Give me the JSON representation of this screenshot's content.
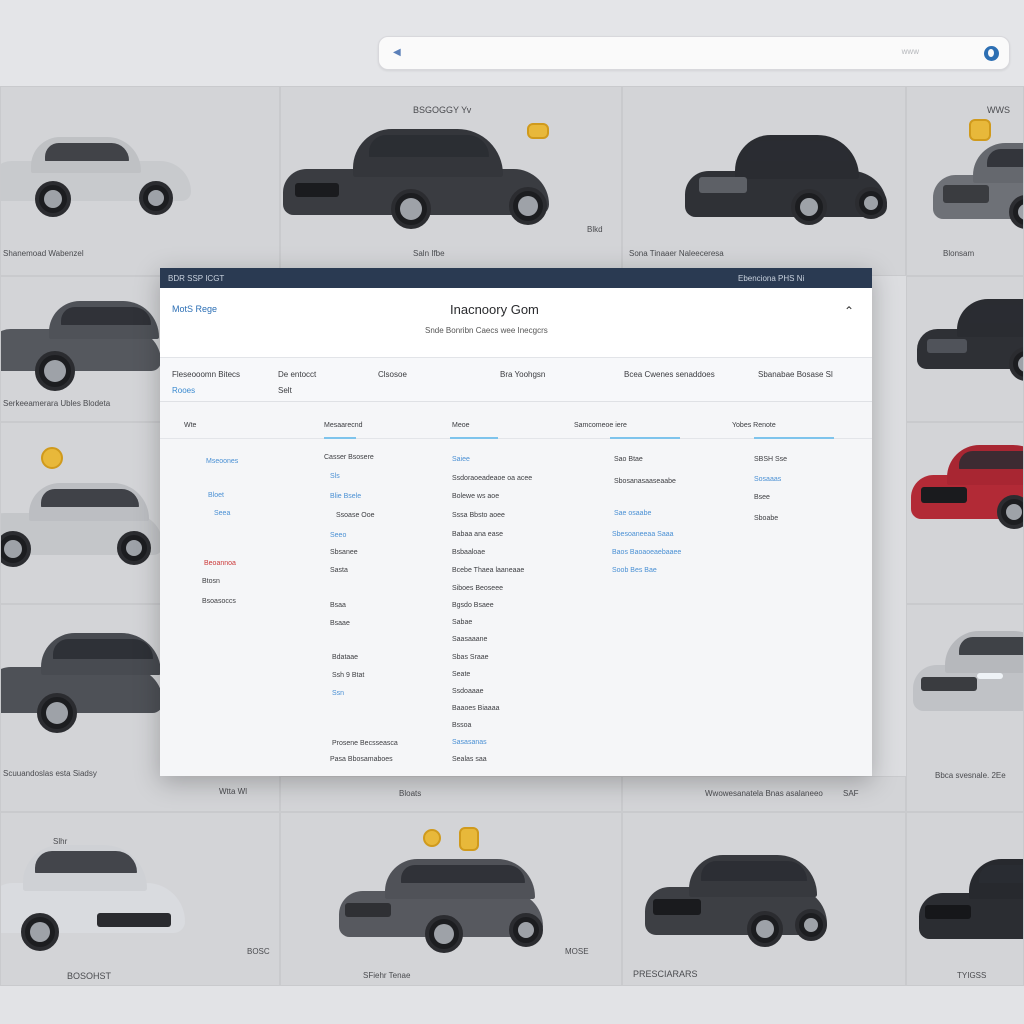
{
  "browser": {
    "url": "www"
  },
  "tiles": {
    "r1c2_top": "BSGOGGY   Yv",
    "r1c1_caption": "Shanemoad   Wabenzel",
    "r1c2_caption": "Saln   Ifbe",
    "r1c2_mark": "Blkd",
    "r1c3_caption": "Sona   Tinaaer Naleeceresa",
    "r1c4_top": "WWS",
    "r1c4_caption": "Blonsam",
    "r2c1_caption": "Serkeeamerara   Ubles   Blodeta",
    "r4c1_caption": "Scuuandoslas esta   Siadsy",
    "r4c1_sub": "Wtta Wl",
    "r4c2_caption": "Bloats",
    "r4c3_caption": "Bbca svesnale. 2Ee",
    "r4c4_caption": "Wwowesanatela Bnas asalaneeo",
    "r4c5_mark": "SAF",
    "r5c1_top": "Slhr",
    "r5c1_caption": "BOSOHST",
    "r5c1_mark": "BOSC",
    "r5c2_caption": "SFiehr Tenae",
    "r5c2_mark": "MOSE",
    "r5c3_caption": "PRESCIARARS",
    "r5c4_caption": "TYIGSS"
  },
  "dialog": {
    "titlebar_left": "BDR  SSP   ICGT",
    "titlebar_right": "Ebenciona   PHS   Ni",
    "brand": "MotS Rege",
    "title": "Inacnoory Gom",
    "subtitle": "Snde Bonribn Caecs   wee Inecgcrs",
    "filters": {
      "f1": "Fleseooomn Bitecs",
      "f2": "De entocct",
      "f3": "Clsosoe",
      "f4": "Bra Yoohgsn",
      "f5": "Bcea Cwenes senaddoes",
      "f6": "Sbanabae Bosase Sl",
      "f1_sub": "Rooes",
      "f2_sub": "Selt"
    },
    "columns": [
      "Wte",
      "Mesaarecnd",
      "Meoe",
      "Samcomeoe iere",
      "Yobes Renote"
    ],
    "col1": [
      "Mseoones",
      "Bloet",
      "Seea",
      "Beoannoa",
      "Btosn",
      "Bsoasoccs"
    ],
    "col2": [
      "Casser Bsosere",
      "Sls",
      "Blie Bsele",
      "Ssoase Ooe",
      "Seeo",
      "Sbsanee",
      "Sasta",
      "Bsaa",
      "Bsaae",
      "Bdataae",
      "Ssh 9 Btat",
      "Ssn",
      "Prosene Becsseasca",
      "Pasa Bbosamaboes"
    ],
    "col3": [
      "Saiee",
      "Ssdoraoeadeaoe oa acee",
      "Bolewe ws aoe",
      "Sssa Bbsto aoee",
      "Babaa ana ease",
      "Bsbaaloae",
      "Bcebe Thaea laaneaae",
      "Siboes Beoseee",
      "Bgsdo Bsaee",
      "Sabae",
      "Saasaaane",
      "Sbas Sraae",
      "Seate",
      "Ssdoaaae",
      "Baaoes Biaaaa",
      "Bssoa",
      "Sasasanas",
      "Sealas saa"
    ],
    "col4": [
      "Sao   Btae",
      "Sbosanasaaseaabe",
      "Sae osaabe",
      "Sbesoaneeaa Saaa",
      "Baos Baoaoeaebaaee",
      "Soob Bes Bae"
    ],
    "col5": [
      "SBSH  Sse",
      "Sosaaas",
      "Bsee",
      "Sboabe"
    ]
  }
}
